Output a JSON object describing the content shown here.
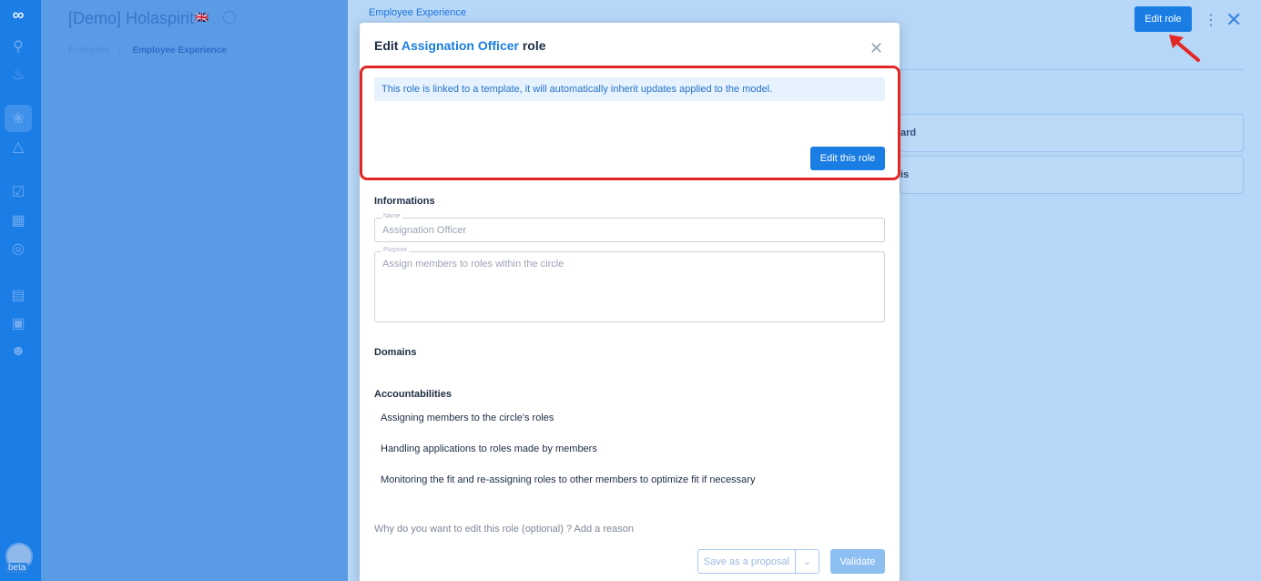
{
  "org": {
    "title": "[Demo] Holaspirit",
    "flag": "🇬🇧"
  },
  "breadcrumb": {
    "parent": "Enterprise",
    "current": "Employee Experience"
  },
  "panel": {
    "crumb": "Employee Experience",
    "edit_role_label": "Edit role",
    "card1_fragment": "ard",
    "card2_fragment": "is"
  },
  "modal": {
    "title_prefix": "Edit",
    "title_role": "Assignation Officer",
    "title_suffix": "role",
    "banner": "This role is linked to a template, it will automatically inherit updates applied to the model.",
    "edit_this_label": "Edit this role",
    "informations_heading": "Informations",
    "name_label": "Name",
    "name_value": "Assignation Officer",
    "purpose_label": "Purpose",
    "purpose_value": "Assign members to roles within the circle",
    "domains_heading": "Domains",
    "accountabilities_heading": "Accountabilities",
    "accountabilities": [
      "Assigning members to the circle's roles",
      "Handling applications to roles made by members",
      "Monitoring the fit and re-assigning roles to other members to optimize fit if necessary"
    ],
    "reason_text": "Why do you want to edit this role (optional) ?  Add a reason",
    "save_proposal_label": "Save as a proposal",
    "validate_label": "Validate"
  },
  "user": {
    "badge": "beta"
  },
  "colors": {
    "accent": "#1a7de4",
    "highlight": "#e32724"
  }
}
